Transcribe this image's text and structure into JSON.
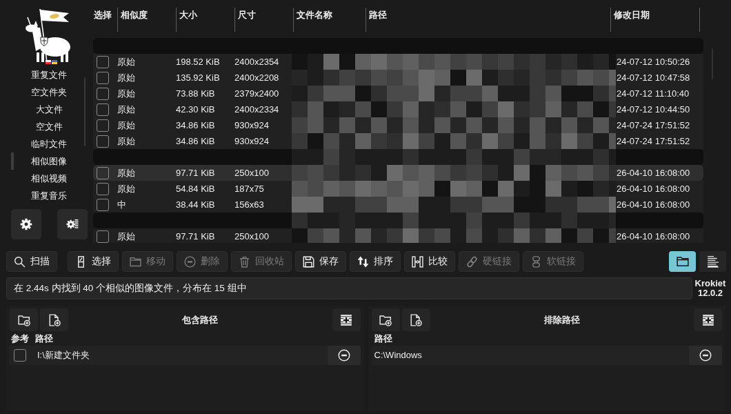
{
  "sidebar": {
    "items": [
      {
        "label": "重复文件",
        "selected": false
      },
      {
        "label": "空文件夹",
        "selected": false
      },
      {
        "label": "大文件",
        "selected": false
      },
      {
        "label": "空文件",
        "selected": false
      },
      {
        "label": "临时文件",
        "selected": false
      },
      {
        "label": "相似图像",
        "selected": true
      },
      {
        "label": "相似视频",
        "selected": false
      },
      {
        "label": "重复音乐",
        "selected": false
      }
    ]
  },
  "table": {
    "columns": [
      "选择",
      "相似度",
      "大小",
      "尺寸",
      "文件名称",
      "路径",
      "修改日期"
    ],
    "rows": [
      {
        "kind": "group"
      },
      {
        "kind": "file",
        "checked": false,
        "selected": false,
        "similarity": "原始",
        "size": "198.52 KiB",
        "dimensions": "2400x2354",
        "modified": "24-07-12 10:50:26"
      },
      {
        "kind": "file",
        "checked": false,
        "selected": false,
        "similarity": "原始",
        "size": "135.92 KiB",
        "dimensions": "2400x2208",
        "modified": "24-07-12 10:47:58"
      },
      {
        "kind": "file",
        "checked": false,
        "selected": false,
        "similarity": "原始",
        "size": "73.88 KiB",
        "dimensions": "2379x2400",
        "modified": "24-07-12 11:10:40"
      },
      {
        "kind": "file",
        "checked": false,
        "selected": false,
        "similarity": "原始",
        "size": "42.30 KiB",
        "dimensions": "2400x2334",
        "modified": "24-07-12 10:44:50"
      },
      {
        "kind": "file",
        "checked": false,
        "selected": false,
        "similarity": "原始",
        "size": "34.86 KiB",
        "dimensions": "930x924",
        "modified": "24-07-24 17:51:52"
      },
      {
        "kind": "file",
        "checked": false,
        "selected": false,
        "similarity": "原始",
        "size": "34.86 KiB",
        "dimensions": "930x924",
        "modified": "24-07-24 17:51:52"
      },
      {
        "kind": "group"
      },
      {
        "kind": "file",
        "checked": false,
        "selected": true,
        "similarity": "原始",
        "size": "97.71 KiB",
        "dimensions": "250x100",
        "modified": "26-04-10 16:08:00"
      },
      {
        "kind": "file",
        "checked": false,
        "selected": false,
        "similarity": "原始",
        "size": "54.84 KiB",
        "dimensions": "187x75",
        "modified": "26-04-10 16:08:00"
      },
      {
        "kind": "file",
        "checked": false,
        "selected": false,
        "similarity": "中",
        "size": "38.44 KiB",
        "dimensions": "156x63",
        "modified": "26-04-10 16:08:00"
      },
      {
        "kind": "group"
      },
      {
        "kind": "file",
        "checked": false,
        "selected": false,
        "similarity": "原始",
        "size": "97.71 KiB",
        "dimensions": "250x100",
        "modified": "26-04-10 16:08:00"
      }
    ]
  },
  "toolbar": {
    "buttons": [
      {
        "label": "扫描",
        "disabled": false
      },
      {
        "label": "选择",
        "disabled": false
      },
      {
        "label": "移动",
        "disabled": true
      },
      {
        "label": "删除",
        "disabled": true
      },
      {
        "label": "回收站",
        "disabled": true
      },
      {
        "label": "保存",
        "disabled": false
      },
      {
        "label": "排序",
        "disabled": false
      },
      {
        "label": "比较",
        "disabled": false
      },
      {
        "label": "硬链接",
        "disabled": true
      },
      {
        "label": "软链接",
        "disabled": true
      }
    ],
    "views": [
      {
        "selected": true
      },
      {
        "selected": false
      }
    ]
  },
  "status_bar": {
    "message": "在 2.44s 内找到 40 个相似的图像文件，分布在 15 组中",
    "app_name": "Krokiet",
    "version": "12.0.2"
  },
  "included_paths": {
    "title": "包含路径",
    "columns": [
      "参考",
      "路径"
    ],
    "rows": [
      {
        "reference": false,
        "path": "I:\\新建文件夹"
      }
    ]
  },
  "excluded_paths": {
    "title": "排除路径",
    "columns": [
      "路径"
    ],
    "rows": [
      {
        "path": "C:\\Windows"
      }
    ]
  }
}
